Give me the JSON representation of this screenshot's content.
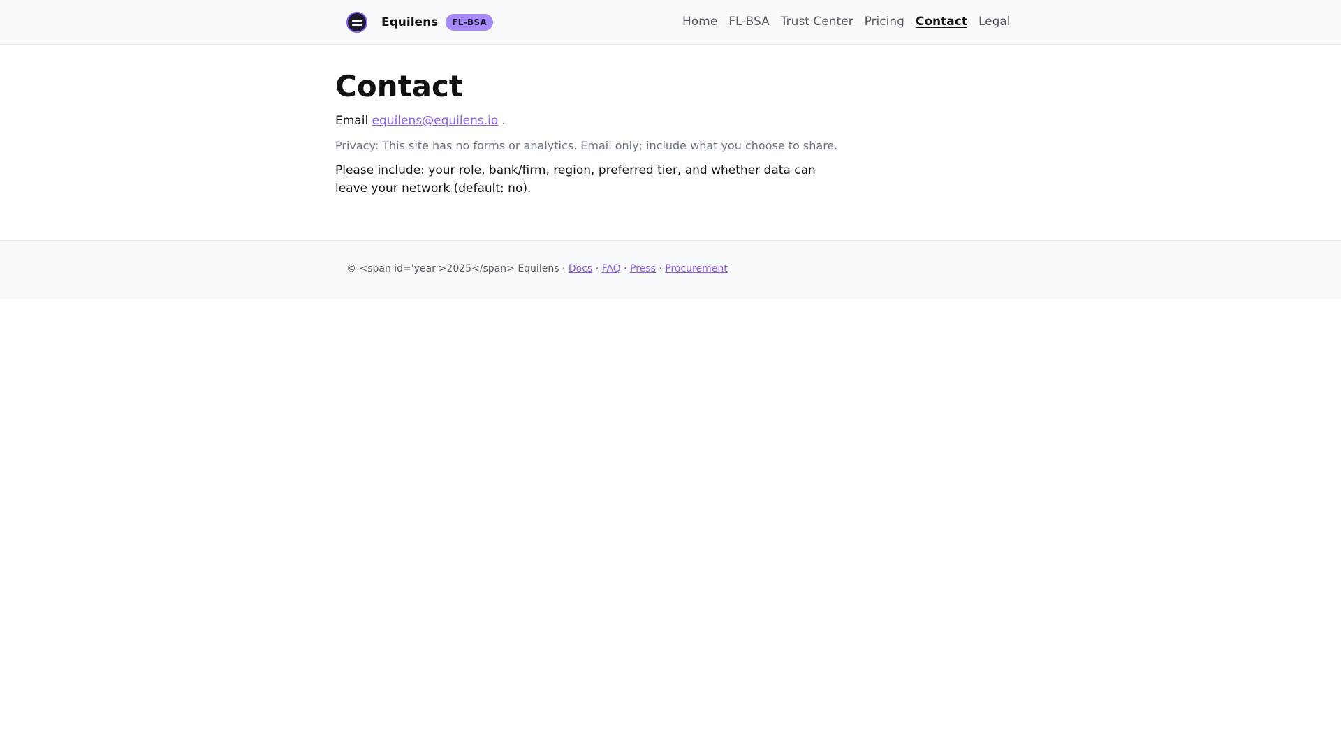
{
  "brand": {
    "name": "Equilens",
    "badge": "FL-BSA"
  },
  "nav": {
    "items": [
      {
        "label": "Home"
      },
      {
        "label": "FL-BSA"
      },
      {
        "label": "Trust Center"
      },
      {
        "label": "Pricing"
      },
      {
        "label": "Contact",
        "active": true
      },
      {
        "label": "Legal"
      }
    ]
  },
  "main": {
    "title": "Contact",
    "email_prefix": "Email",
    "email_link": "equilens@equilens.io",
    "email_suffix": ".",
    "privacy": "Privacy: This site has no forms or analytics. Email only; include what you choose to share.",
    "include": "Please include: your role, bank/firm, region, preferred tier, and whether data can leave your network (default: no)."
  },
  "footer": {
    "copyright": "© <span id='year'>2025</span> Equilens",
    "sep": "·",
    "links": [
      "Docs",
      "FAQ",
      "Press",
      "Procurement"
    ]
  },
  "colors": {
    "accent": "#8b5cf6",
    "badge_bg": "#a78bfa",
    "header_bg": "#f8f9fb",
    "muted_text": "#6b7280"
  }
}
